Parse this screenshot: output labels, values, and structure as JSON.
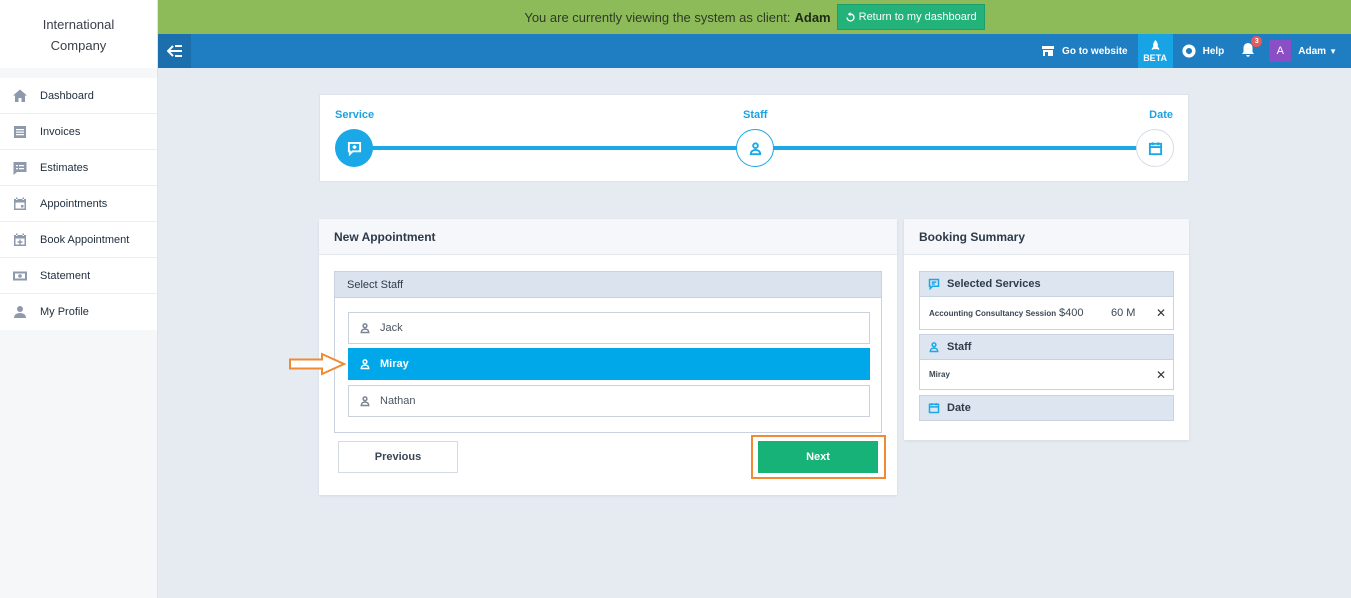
{
  "brand": {
    "line1": "International",
    "line2": "Company"
  },
  "sidebar": {
    "items": [
      {
        "label": "Dashboard",
        "icon": "home-icon"
      },
      {
        "label": "Invoices",
        "icon": "invoice-icon"
      },
      {
        "label": "Estimates",
        "icon": "estimate-icon"
      },
      {
        "label": "Appointments",
        "icon": "calendar-icon"
      },
      {
        "label": "Book Appointment",
        "icon": "calendar-plus-icon"
      },
      {
        "label": "Statement",
        "icon": "money-icon"
      },
      {
        "label": "My Profile",
        "icon": "user-icon"
      }
    ]
  },
  "banner": {
    "text": "You are currently viewing the system as client:",
    "client": "Adam",
    "return_label": "Return to my dashboard"
  },
  "topbar": {
    "website_label": "Go to website",
    "beta_label": "BETA",
    "help_label": "Help",
    "notification_count": "3",
    "avatar_letter": "A",
    "user_name": "Adam"
  },
  "stepper": {
    "steps": [
      {
        "label": "Service"
      },
      {
        "label": "Staff"
      },
      {
        "label": "Date"
      }
    ]
  },
  "appointment": {
    "title": "New Appointment",
    "select_staff_label": "Select Staff",
    "staff": [
      {
        "name": "Jack"
      },
      {
        "name": "Miray",
        "selected": true
      },
      {
        "name": "Nathan"
      }
    ],
    "previous_label": "Previous",
    "next_label": "Next"
  },
  "summary": {
    "title": "Booking Summary",
    "services_label": "Selected Services",
    "service": {
      "name": "Accounting Consultancy Session",
      "price": "$400",
      "duration": "60 M"
    },
    "staff_label": "Staff",
    "staff_value": "Miray",
    "date_label": "Date"
  },
  "colors": {
    "accent": "#1ba8e6",
    "next_button": "#17b277",
    "banner": "#8dbb5a",
    "topbar": "#1f7ec1",
    "highlight_annotation": "#f08a33"
  }
}
